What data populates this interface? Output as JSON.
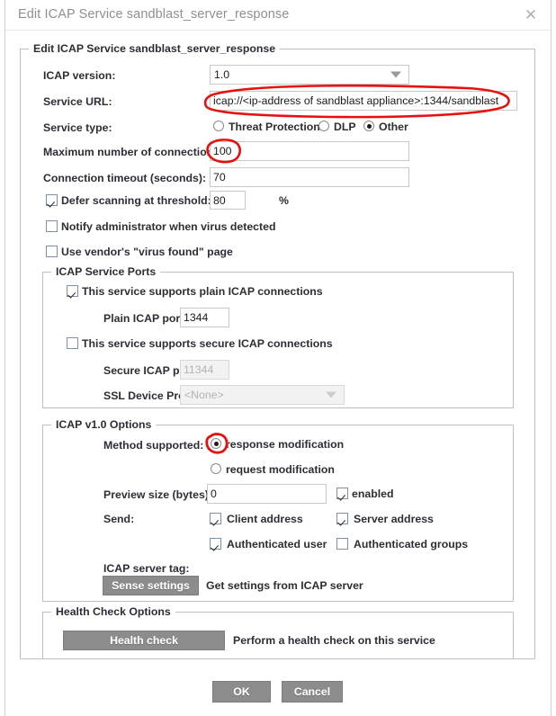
{
  "window": {
    "title": "Edit ICAP Service sandblast_server_response",
    "close_icon": "close-icon"
  },
  "main_group": {
    "legend": "Edit ICAP Service sandblast_server_response",
    "icap_version": {
      "label": "ICAP version:",
      "value": "1.0"
    },
    "service_url": {
      "label": "Service URL:",
      "value": "icap://<ip-address of sandblast appliance>:1344/sandblast"
    },
    "service_type": {
      "label": "Service type:",
      "options": [
        "Threat Protection",
        "DLP",
        "Other"
      ],
      "selected": "Other"
    },
    "max_connections": {
      "label": "Maximum number of connections:",
      "value": "100"
    },
    "connection_timeout": {
      "label": "Connection timeout (seconds):",
      "value": "70"
    },
    "defer_scanning": {
      "label": "Defer scanning at threshold:",
      "checked": true,
      "value": "80",
      "unit": "%"
    },
    "notify_admin": {
      "label": "Notify administrator when virus detected",
      "checked": false
    },
    "vendor_page": {
      "label": "Use vendor's \"virus found\" page",
      "checked": false
    }
  },
  "service_ports": {
    "legend": "ICAP Service Ports",
    "plain_supported": {
      "label": "This service supports plain ICAP connections",
      "checked": true
    },
    "plain_port": {
      "label": "Plain ICAP port:",
      "value": "1344"
    },
    "secure_supported": {
      "label": "This service supports secure ICAP connections",
      "checked": false
    },
    "secure_port": {
      "label": "Secure ICAP port:",
      "value": "11344"
    },
    "ssl_profile": {
      "label": "SSL Device Profile:",
      "value": "<None>"
    }
  },
  "v1_options": {
    "legend": "ICAP v1.0 Options",
    "method_supported": {
      "label": "Method supported:",
      "options": [
        "response modification",
        "request modification"
      ],
      "selected": "response modification"
    },
    "preview_size": {
      "label": "Preview size (bytes):",
      "value": "0"
    },
    "preview_enabled": {
      "label": "enabled",
      "checked": true
    },
    "send": {
      "label": "Send:",
      "client_address": {
        "label": "Client address",
        "checked": true
      },
      "server_address": {
        "label": "Server address",
        "checked": true
      },
      "authenticated_user": {
        "label": "Authenticated user",
        "checked": true
      },
      "authenticated_groups": {
        "label": "Authenticated groups",
        "checked": false
      }
    },
    "server_tag": {
      "label": "ICAP server tag:"
    },
    "sense_settings": {
      "button": "Sense settings",
      "description": "Get settings from ICAP server"
    }
  },
  "health_check": {
    "legend": "Health Check Options",
    "button": "Health check",
    "description": "Perform a health check on this service"
  },
  "footer": {
    "ok": "OK",
    "cancel": "Cancel"
  },
  "annotations": {
    "color": "#e8100f",
    "items": [
      "service-url-circle",
      "max-connections-circle",
      "response-modification-circle"
    ]
  }
}
